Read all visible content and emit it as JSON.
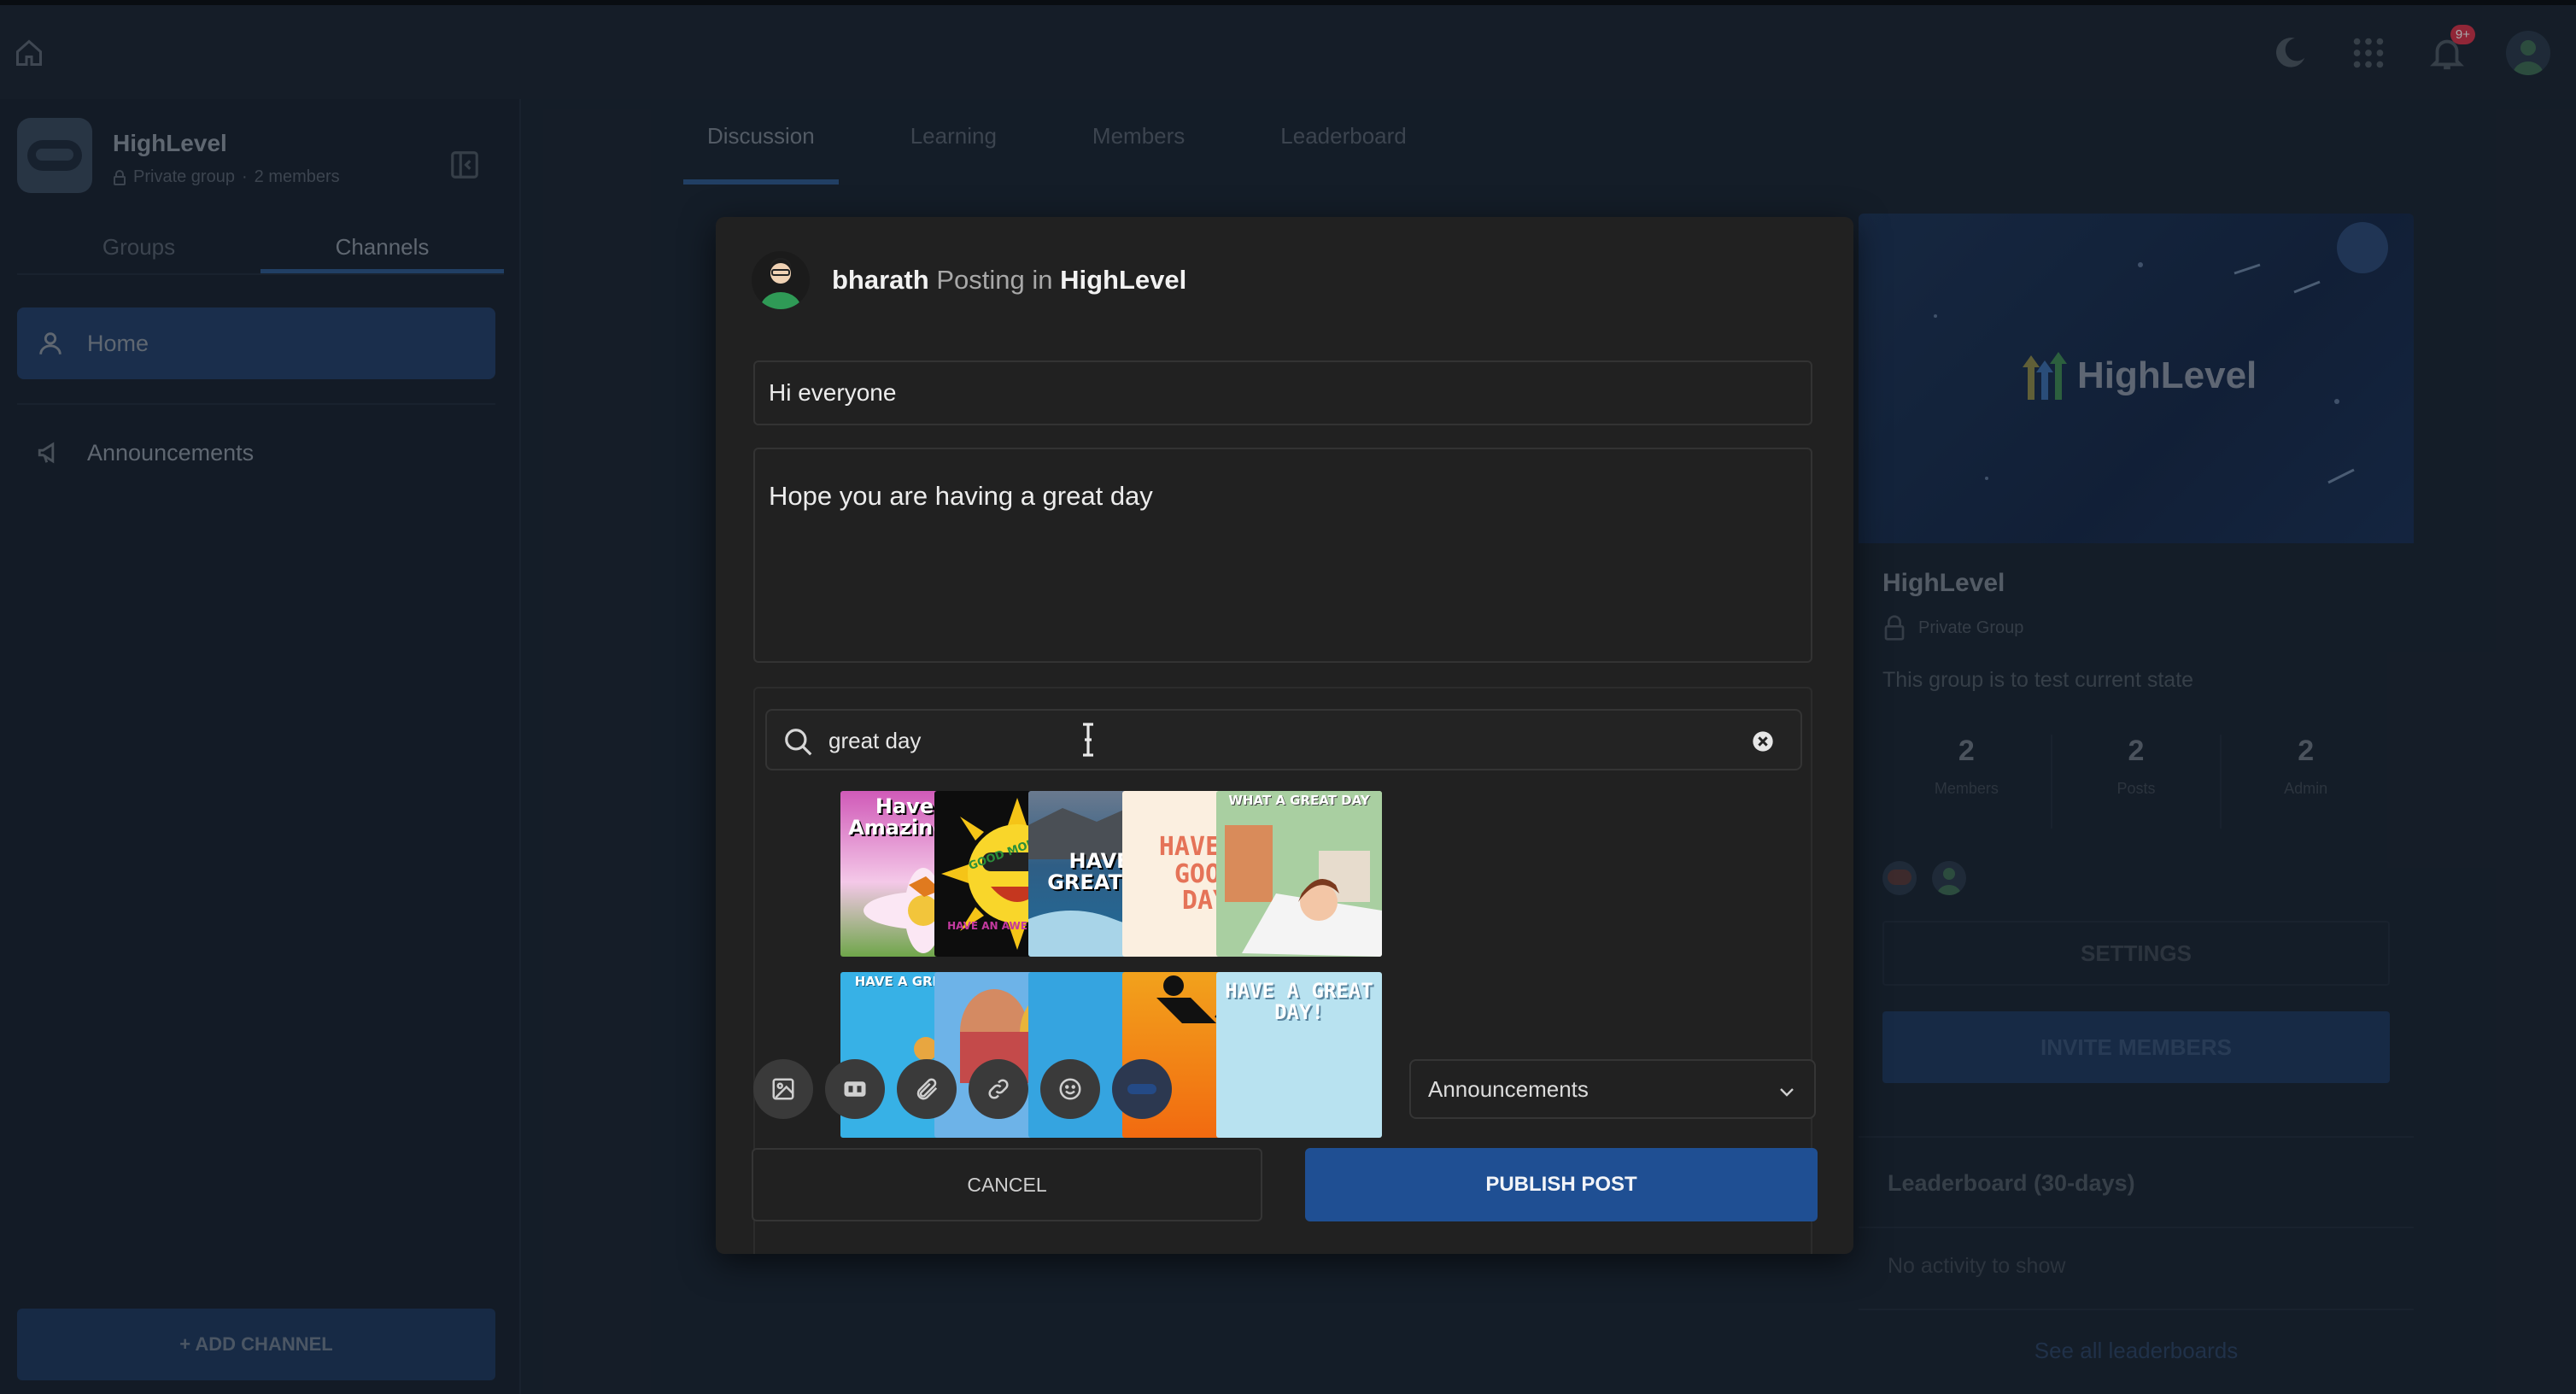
{
  "app": {
    "group_name": "HighLevel",
    "group_privacy": "Private group",
    "group_members": "2 members",
    "notifications_badge": "9+",
    "accent_color": "#1f4f93"
  },
  "sidebar": {
    "tabs": [
      {
        "label": "Groups",
        "active": false
      },
      {
        "label": "Channels",
        "active": true
      }
    ],
    "items": [
      {
        "label": "Home",
        "icon": "user-icon",
        "active": true
      },
      {
        "label": "Announcements",
        "icon": "megaphone-icon",
        "active": false
      }
    ],
    "add_channel_label": "+ ADD CHANNEL"
  },
  "main_tabs": [
    {
      "label": "Discussion",
      "active": true
    },
    {
      "label": "Learning",
      "active": false
    },
    {
      "label": "Members",
      "active": false
    },
    {
      "label": "Leaderboard",
      "active": false
    }
  ],
  "right_panel": {
    "banner_text": "HighLevel",
    "name": "HighLevel",
    "privacy": "Private Group",
    "description": "This group is to test current state",
    "stats": [
      {
        "value": "2",
        "label": "Members"
      },
      {
        "value": "2",
        "label": "Posts"
      },
      {
        "value": "2",
        "label": "Admin"
      }
    ],
    "settings_label": "SETTINGS",
    "invite_label": "INVITE MEMBERS",
    "leaderboard_title": "Leaderboard (30-days)",
    "no_activity": "No activity to show",
    "see_all": "See all leaderboards"
  },
  "modal": {
    "author": "bharath",
    "posting_in_text": "Posting in",
    "group": "HighLevel",
    "title_value": "Hi everyone",
    "body_value": "Hope you are having a great day",
    "gif_search_value": "great day",
    "gifs": [
      {
        "caption": "Have An Amazing Day"
      },
      {
        "caption": "GOOD MORNING",
        "subcaption": "HAVE AN AWESOME DAY"
      },
      {
        "caption": "HAVE A GREAT DAY"
      },
      {
        "caption": "HAVE A GOOD DAY"
      },
      {
        "caption": "WHAT A GREAT DAY"
      },
      {
        "caption": "HAVE A GREAT DAY"
      },
      {
        "caption": ""
      },
      {
        "caption": ""
      },
      {
        "caption": ""
      },
      {
        "caption": "HAVE A GREAT DAY!"
      }
    ],
    "toolbar_icons": [
      "image-icon",
      "gif-icon",
      "attachment-icon",
      "link-icon",
      "emoji-icon",
      "video-icon"
    ],
    "channel_selected": "Announcements",
    "cancel_label": "CANCEL",
    "publish_label": "PUBLISH POST"
  }
}
